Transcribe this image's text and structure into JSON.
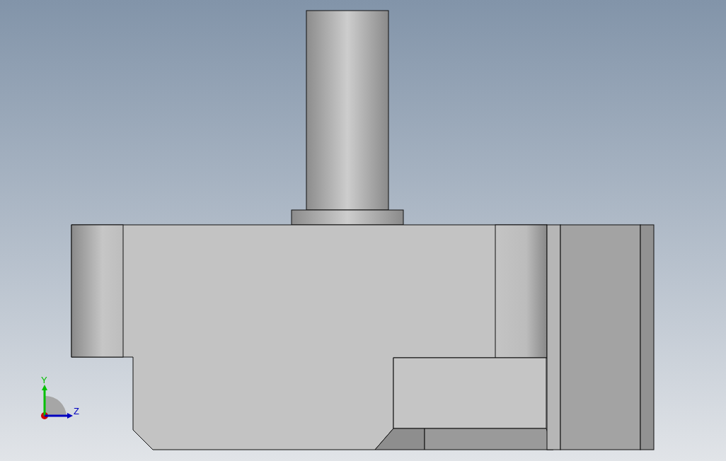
{
  "viewport": {
    "triad": {
      "axes": [
        {
          "kind": "vertical",
          "label": "Y",
          "color": "#00c000"
        },
        {
          "kind": "horizontal",
          "label": "Z",
          "color": "#0000c0"
        }
      ]
    }
  }
}
